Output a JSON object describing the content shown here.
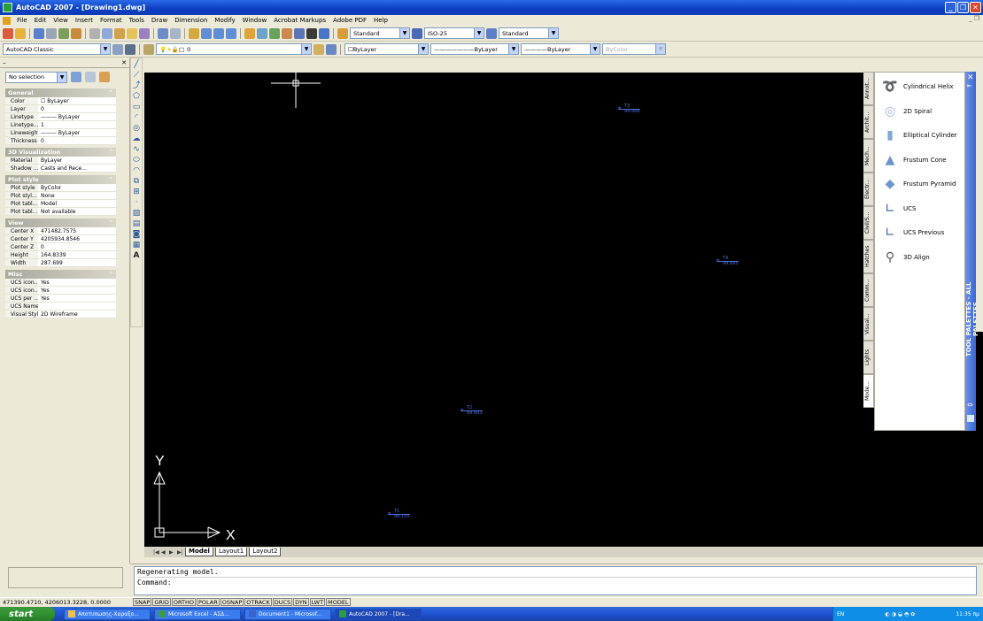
{
  "window": {
    "title": "AutoCAD 2007 - [Drawing1.dwg]"
  },
  "menu": [
    "File",
    "Edit",
    "View",
    "Insert",
    "Format",
    "Tools",
    "Draw",
    "Dimension",
    "Modify",
    "Window",
    "Acrobat Markups",
    "Adobe PDF",
    "Help"
  ],
  "toolbar1": {
    "text_style": "Standard",
    "dim_style": "ISO-25",
    "table_style": "Standard"
  },
  "toolbar2": {
    "workspace": "AutoCAD Classic",
    "layer": "0",
    "color": "ByLayer",
    "linetype": "ByLayer",
    "lineweight": "ByLayer",
    "plotstyle": "ByColor"
  },
  "properties": {
    "selection": "No selection",
    "sections": [
      {
        "title": "General",
        "rows": [
          [
            "Color",
            "☐ ByLayer"
          ],
          [
            "Layer",
            "0"
          ],
          [
            "Linetype",
            "——— ByLayer"
          ],
          [
            "Linetype...",
            "1"
          ],
          [
            "Lineweight",
            "——— ByLayer"
          ],
          [
            "Thickness",
            "0"
          ]
        ]
      },
      {
        "title": "3D Visualization",
        "rows": [
          [
            "Material",
            "ByLayer"
          ],
          [
            "Shadow ...",
            "Casts and Rece..."
          ]
        ]
      },
      {
        "title": "Plot style",
        "rows": [
          [
            "Plot style",
            "ByColor"
          ],
          [
            "Plot styl...",
            "None"
          ],
          [
            "Plot tabl...",
            "Model"
          ],
          [
            "Plot tabl...",
            "Not available"
          ]
        ]
      },
      {
        "title": "View",
        "rows": [
          [
            "Center X",
            "471482.7575"
          ],
          [
            "Center Y",
            "4205934.8546"
          ],
          [
            "Center Z",
            "0"
          ],
          [
            "Height",
            "164.8339"
          ],
          [
            "Width",
            "287.699"
          ]
        ]
      },
      {
        "title": "Misc",
        "rows": [
          [
            "UCS icon...",
            "Yes"
          ],
          [
            "UCS icon...",
            "Yes"
          ],
          [
            "UCS per ...",
            "Yes"
          ],
          [
            "UCS Name",
            ""
          ],
          [
            "Visual Style",
            "2D Wireframe"
          ]
        ]
      }
    ]
  },
  "canvas": {
    "ucs_x": "X",
    "ucs_y": "Y",
    "markers": [
      {
        "label": "T3",
        "value": "99.888"
      },
      {
        "label": "T4",
        "value": "99.895"
      },
      {
        "label": "T2",
        "value": "99.893"
      },
      {
        "label": "T1",
        "value": "99.155"
      }
    ]
  },
  "layout_tabs": [
    "Model",
    "Layout1",
    "Layout2"
  ],
  "command": {
    "line1": "Regenerating model.",
    "line2": "Command:"
  },
  "status": {
    "coords": "471390.4710, 4206013.3228, 0.0000",
    "buttons": [
      "SNAP",
      "GRID",
      "ORTHO",
      "POLAR",
      "OSNAP",
      "OTRACK",
      "DUCS",
      "DYN",
      "LWT",
      "MODEL"
    ]
  },
  "palette": {
    "title": "TOOL PALETTES - ALL PALETTES",
    "tabs": [
      "Annot...",
      "Archit...",
      "Mech...",
      "Electr...",
      "Civil/S...",
      "Hatches",
      "Comm...",
      "Visual...",
      "Lights",
      "Mode..."
    ],
    "items": [
      "Cylindrical Helix",
      "2D Spiral",
      "Elliptical Cylinder",
      "Frustum Cone",
      "Frustum Pyramid",
      "UCS",
      "UCS Previous",
      "3D Align"
    ]
  },
  "taskbar": {
    "start": "start",
    "tasks": [
      "Αποτυπωσης-Χαραξο...",
      "Microsoft Excel - ΑΣΔ...",
      "Document1 - Microsof...",
      "AutoCAD 2007 - [Dra..."
    ],
    "lang": "EN",
    "clock": "11:35 πμ"
  },
  "colors": {
    "accent": "#0a3fc0",
    "canvas": "#000000",
    "marker": "#4d6ee0",
    "palette_strip": "#3a66d3"
  }
}
